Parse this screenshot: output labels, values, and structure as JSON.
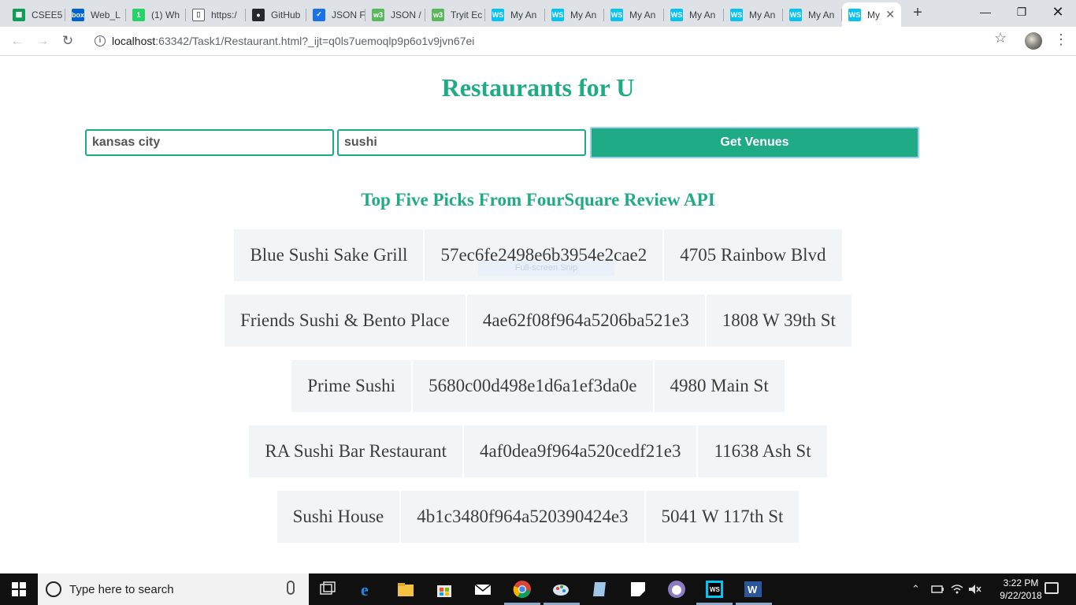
{
  "browser": {
    "tabs": [
      {
        "title": "CSEE5",
        "icon": "sheets-icon",
        "color": "#0f9d58",
        "glyph": "▦"
      },
      {
        "title": "Web_L",
        "icon": "box-icon",
        "color": "#0061d5",
        "glyph": "box"
      },
      {
        "title": "(1) Wh",
        "icon": "whatsapp-icon",
        "color": "#25d366",
        "glyph": "1"
      },
      {
        "title": "https:/",
        "icon": "document-icon",
        "color": "#ffffff",
        "glyph": "▯"
      },
      {
        "title": "GitHub",
        "icon": "github-icon",
        "color": "#24292e",
        "glyph": "●"
      },
      {
        "title": "JSON F",
        "icon": "checkbox-icon",
        "color": "#1a73e8",
        "glyph": "✓"
      },
      {
        "title": "JSON /",
        "icon": "w3-icon",
        "color": "#5cb85c",
        "glyph": "w3"
      },
      {
        "title": "Tryit Ec",
        "icon": "w3-icon",
        "color": "#5cb85c",
        "glyph": "w3"
      },
      {
        "title": "My An",
        "icon": "webstorm-icon",
        "color": "#07c3f2",
        "glyph": "WS"
      },
      {
        "title": "My An",
        "icon": "webstorm-icon",
        "color": "#07c3f2",
        "glyph": "WS"
      },
      {
        "title": "My An",
        "icon": "webstorm-icon",
        "color": "#07c3f2",
        "glyph": "WS"
      },
      {
        "title": "My An",
        "icon": "webstorm-icon",
        "color": "#07c3f2",
        "glyph": "WS"
      },
      {
        "title": "My An",
        "icon": "webstorm-icon",
        "color": "#07c3f2",
        "glyph": "WS"
      },
      {
        "title": "My An",
        "icon": "webstorm-icon",
        "color": "#07c3f2",
        "glyph": "WS"
      },
      {
        "title": "My",
        "icon": "webstorm-icon",
        "color": "#07c3f2",
        "glyph": "WS",
        "active": true
      }
    ],
    "url_host": "localhost",
    "url_rest": ":63342/Task1/Restaurant.html?_ijt=q0ls7uemoqlp9p6o1v9jvn67ei"
  },
  "page": {
    "title": "Restaurants for U",
    "city_value": "kansas city",
    "query_value": "sushi",
    "button_label": "Get Venues",
    "subtitle": "Top Five Picks From FourSquare Review API",
    "overlay_text": "Full-screen Snip",
    "venues": [
      {
        "name": "Blue Sushi Sake Grill",
        "id": "57ec6fe2498e6b3954e2cae2",
        "address": "4705 Rainbow Blvd"
      },
      {
        "name": "Friends Sushi & Bento Place",
        "id": "4ae62f08f964a5206ba521e3",
        "address": "1808 W 39th St"
      },
      {
        "name": "Prime Sushi",
        "id": "5680c00d498e1d6a1ef3da0e",
        "address": "4980 Main St"
      },
      {
        "name": "RA Sushi Bar Restaurant",
        "id": "4af0dea9f964a520cedf21e3",
        "address": "11638 Ash St"
      },
      {
        "name": "Sushi House",
        "id": "4b1c3480f964a520390424e3",
        "address": "5041 W 117th St"
      }
    ]
  },
  "taskbar": {
    "search_placeholder": "Type here to search",
    "time": "3:22 PM",
    "date": "9/22/2018"
  }
}
